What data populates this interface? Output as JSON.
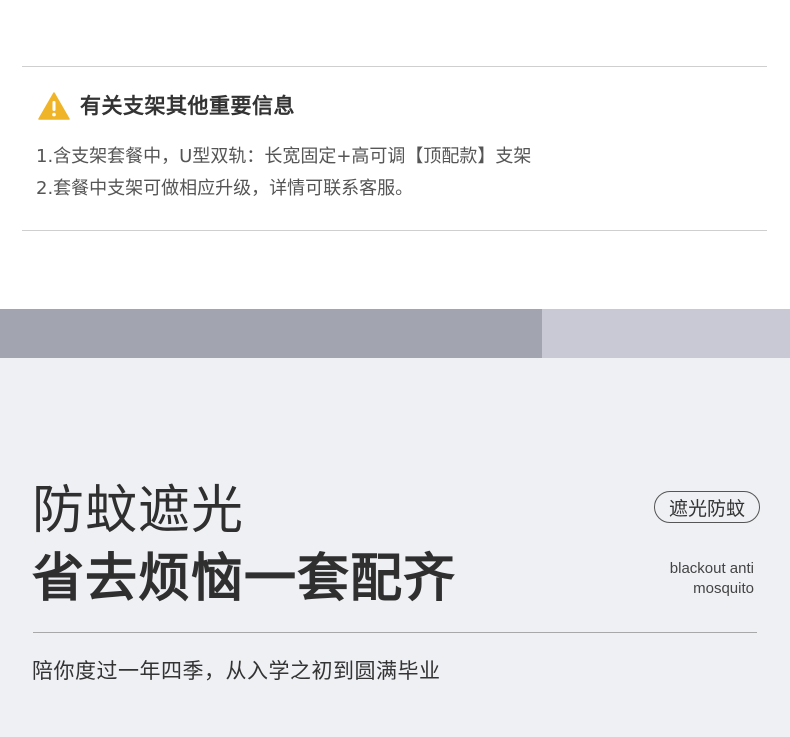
{
  "notice": {
    "icon": "warning-icon",
    "icon_color": "#f0b429",
    "title": "有关支架其他重要信息",
    "lines": [
      "1.含支架套餐中，U型双轨：长宽固定+高可调【顶配款】支架",
      "2.套餐中支架可做相应升级，详情可联系客服。"
    ]
  },
  "band": {
    "dark_color": "#a2a4b0",
    "light_color": "#c8c9d5"
  },
  "feature": {
    "background": "#eff0f4",
    "headline_1": "防蚊遮光",
    "headline_2": "省去烦恼一套配齐",
    "tag": "遮光防蚊",
    "en_tag_line_1": "blackout anti",
    "en_tag_line_2": "mosquito",
    "subtitle": "陪你度过一年四季，从入学之初到圆满毕业"
  }
}
